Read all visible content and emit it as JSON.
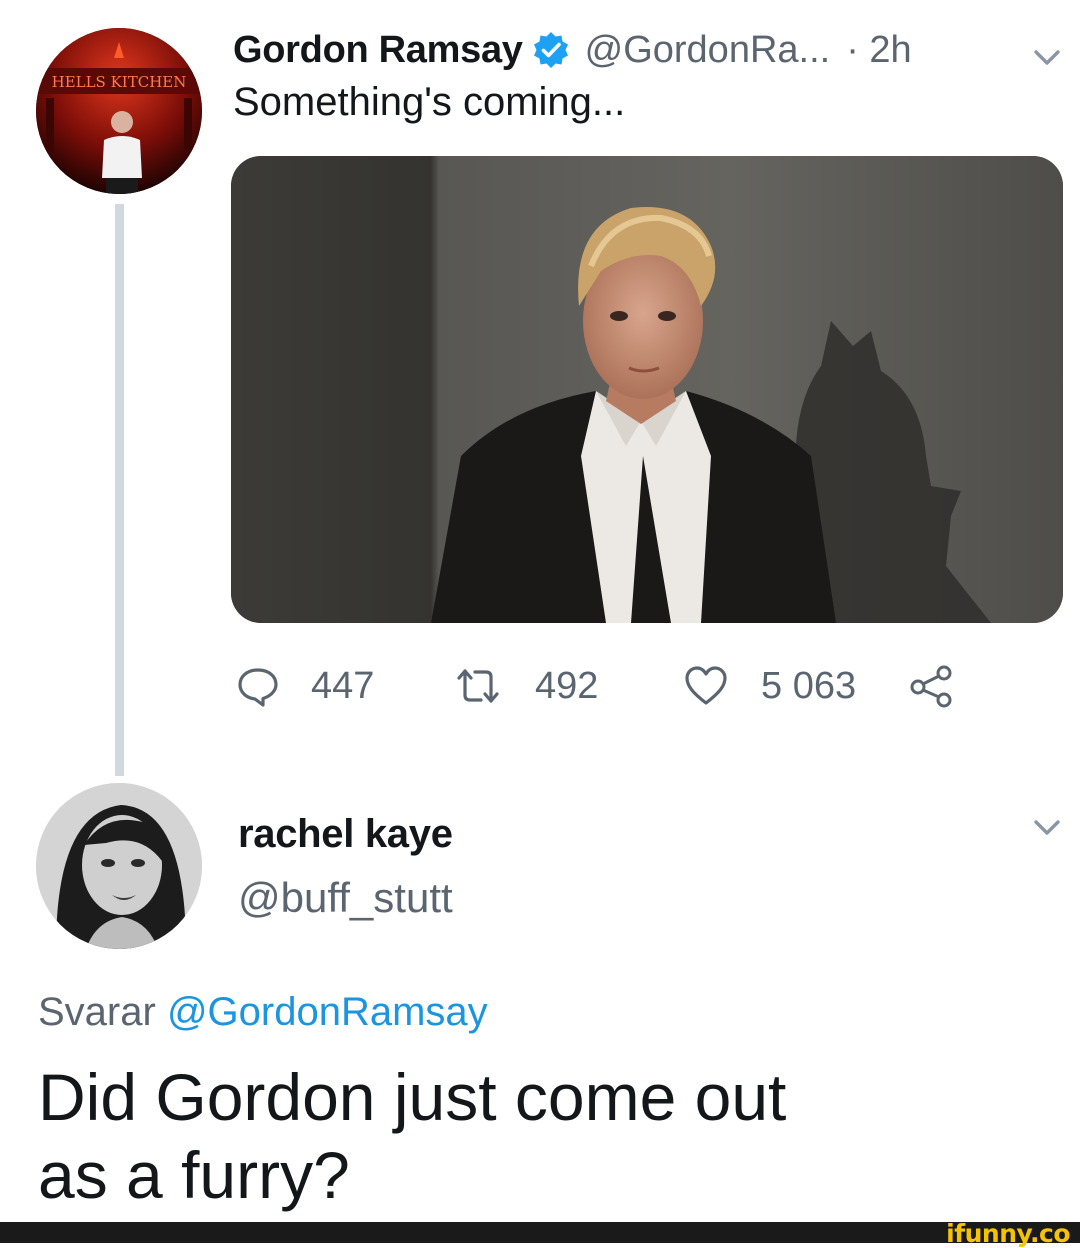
{
  "tweet": {
    "author_name": "Gordon Ramsay",
    "handle": "@GordonRa...",
    "time": "· 2h",
    "text": "Something's coming...",
    "avatar_sign": "HELLS KITCHEN",
    "stats": {
      "replies": "447",
      "retweets": "492",
      "likes": "5 063"
    }
  },
  "reply": {
    "author_name": "rachel kaye",
    "handle": "@buff_stutt",
    "replying_prefix": "Svarar",
    "replying_to": "@GordonRamsay",
    "text_line1": "Did Gordon just come out",
    "text_line2": "as a furry?"
  },
  "watermark": "ifunny.co",
  "colors": {
    "verified": "#1da1f2",
    "secondary_text": "#5b6570",
    "mention": "#1b95e0",
    "thread_line": "#cfd9de",
    "watermark": "#f5c400"
  },
  "icons": [
    "verified-badge-icon",
    "chevron-down-icon",
    "reply-icon",
    "retweet-icon",
    "like-icon",
    "share-icon"
  ]
}
